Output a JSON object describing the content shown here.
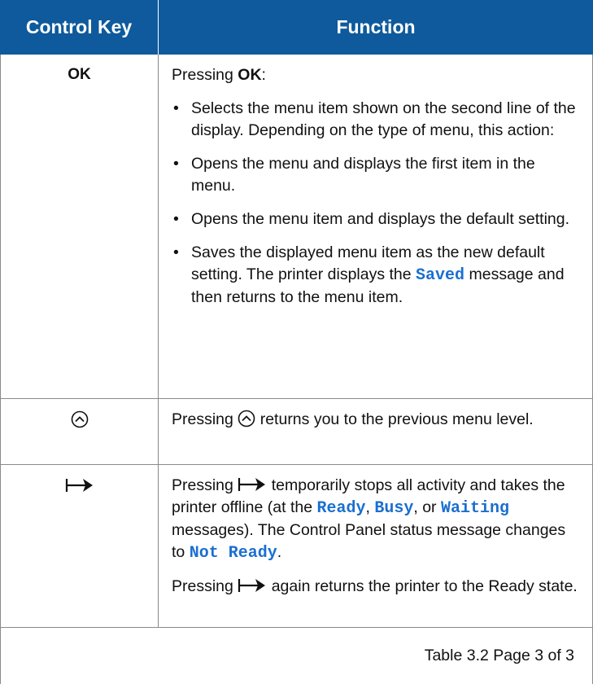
{
  "header": {
    "col1": "Control Key",
    "col2": "Function"
  },
  "rows": [
    {
      "key": "OK",
      "intro_pre": "Pressing ",
      "intro_bold": "OK",
      "intro_post": ":",
      "bullets": [
        "Selects the menu item shown on the second line of the display. Depending on the type of menu, this action:",
        "Opens the menu and displays the first item in the menu.",
        "Opens the menu item and displays the default setting."
      ],
      "last_bullet_pre": "Saves the displayed menu item as the new default setting. The printer displays the ",
      "last_bullet_code": "Saved",
      "last_bullet_post": " message and then returns to the menu item."
    },
    {
      "key_icon": "up-arrow-circle-icon",
      "text_pre": "Pressing ",
      "text_post": " returns you to the previous menu level."
    },
    {
      "key_icon": "online-offline-icon",
      "p1_pre": "Pressing ",
      "p1_mid": " temporarily stops all activity and takes the printer offline (at the ",
      "p1_code1": "Ready",
      "p1_sep1": ", ",
      "p1_code2": "Busy",
      "p1_sep2": ", or ",
      "p1_code3": "Waiting",
      "p1_mid2": " messages). The Control Panel status message changes to ",
      "p1_code4": "Not Ready",
      "p1_end": ".",
      "p2_pre": "Pressing ",
      "p2_post": " again returns the printer to the Ready state."
    }
  ],
  "footer": "Table 3.2  Page 3 of 3"
}
